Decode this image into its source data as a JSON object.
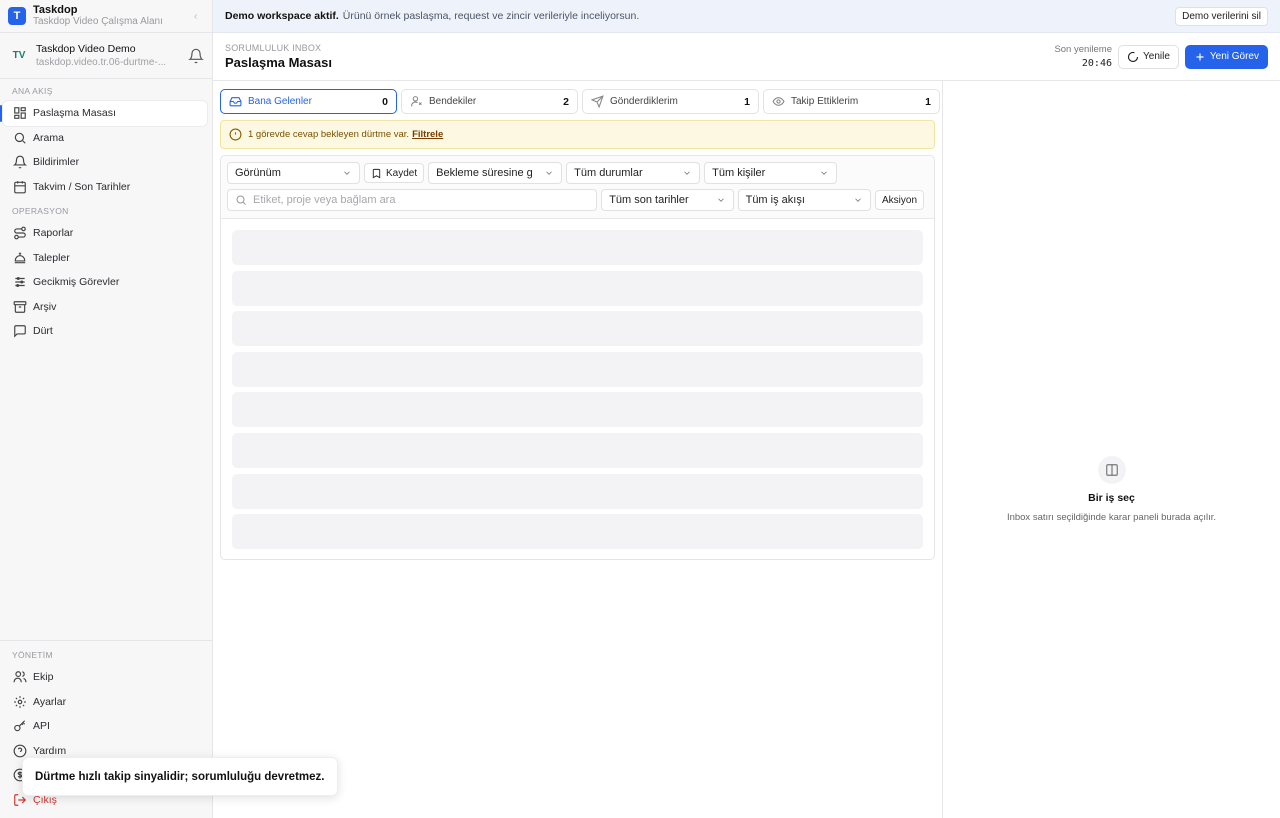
{
  "brand": {
    "logo_letter": "T",
    "title": "Taskdop",
    "subtitle": "Taskdop Video Çalışma Alanı"
  },
  "workspace": {
    "avatar": "TV",
    "title": "Taskdop Video Demo",
    "subtitle": "taskdop.video.tr.06-durtme-..."
  },
  "sidebar": {
    "section_main": "ANA AKIŞ",
    "main_items": [
      {
        "label": "Paslaşma Masası",
        "icon": "grid-icon",
        "active": true
      },
      {
        "label": "Arama",
        "icon": "search-icon"
      },
      {
        "label": "Bildirimler",
        "icon": "bell-icon"
      },
      {
        "label": "Takvim / Son Tarihler",
        "icon": "calendar-icon"
      }
    ],
    "section_ops": "OPERASYON",
    "ops_items": [
      {
        "label": "Raporlar",
        "icon": "route-icon"
      },
      {
        "label": "Talepler",
        "icon": "concierge-bell-icon"
      },
      {
        "label": "Gecikmiş Görevler",
        "icon": "sliders-icon"
      },
      {
        "label": "Arşiv",
        "icon": "archive-icon"
      },
      {
        "label": "Dürt",
        "icon": "message-icon"
      }
    ],
    "section_admin": "YÖNETİM",
    "admin_items": [
      {
        "label": "Ekip",
        "icon": "users-icon"
      },
      {
        "label": "Ayarlar",
        "icon": "gear-icon"
      },
      {
        "label": "API",
        "icon": "key-icon"
      },
      {
        "label": "Yardım",
        "icon": "help-icon"
      }
    ],
    "logout_label": "Çıkış"
  },
  "banner": {
    "bold": "Demo workspace aktif.",
    "text": "Ürünü örnek paslaşma, request ve zincir verileriyle inceliyorsun.",
    "button": "Demo verilerini sil"
  },
  "header": {
    "eyebrow": "SORUMLULUK INBOX",
    "title": "Paslaşma Masası",
    "refresh_label": "Son yenileme",
    "refresh_time": "20:46",
    "refresh_button": "Yenile",
    "new_task_button": "Yeni Görev"
  },
  "tabs": [
    {
      "label": "Bana Gelenler",
      "count": "0",
      "icon": "inbox-icon",
      "active": true
    },
    {
      "label": "Bendekiler",
      "count": "2",
      "icon": "user-icon"
    },
    {
      "label": "Gönderdiklerim",
      "count": "1",
      "icon": "send-icon"
    },
    {
      "label": "Takip Ettiklerim",
      "count": "1",
      "icon": "eye-icon"
    }
  ],
  "alert": {
    "text": "1 görevde cevap bekleyen dürtme var.",
    "link": "Filtrele"
  },
  "filters": {
    "view": "Görünüm",
    "save": "Kaydet",
    "wait_sort": "Bekleme süresine g",
    "status": "Tüm durumlar",
    "people": "Tüm kişiler",
    "search_placeholder": "Etiket, proje veya bağlam ara",
    "deadlines": "Tüm son tarihler",
    "workflow": "Tüm iş akışı",
    "action": "Aksiyon"
  },
  "detail": {
    "title": "Bir iş seç",
    "subtitle": "Inbox satırı seçildiğinde karar paneli burada açılır."
  },
  "toast": {
    "text": "Dürtme hızlı takip sinyalidir; sorumluluğu devretmez."
  },
  "colors": {
    "accent": "#2563eb",
    "alert_bg": "#fdf8e1",
    "logout": "#d0352f"
  }
}
